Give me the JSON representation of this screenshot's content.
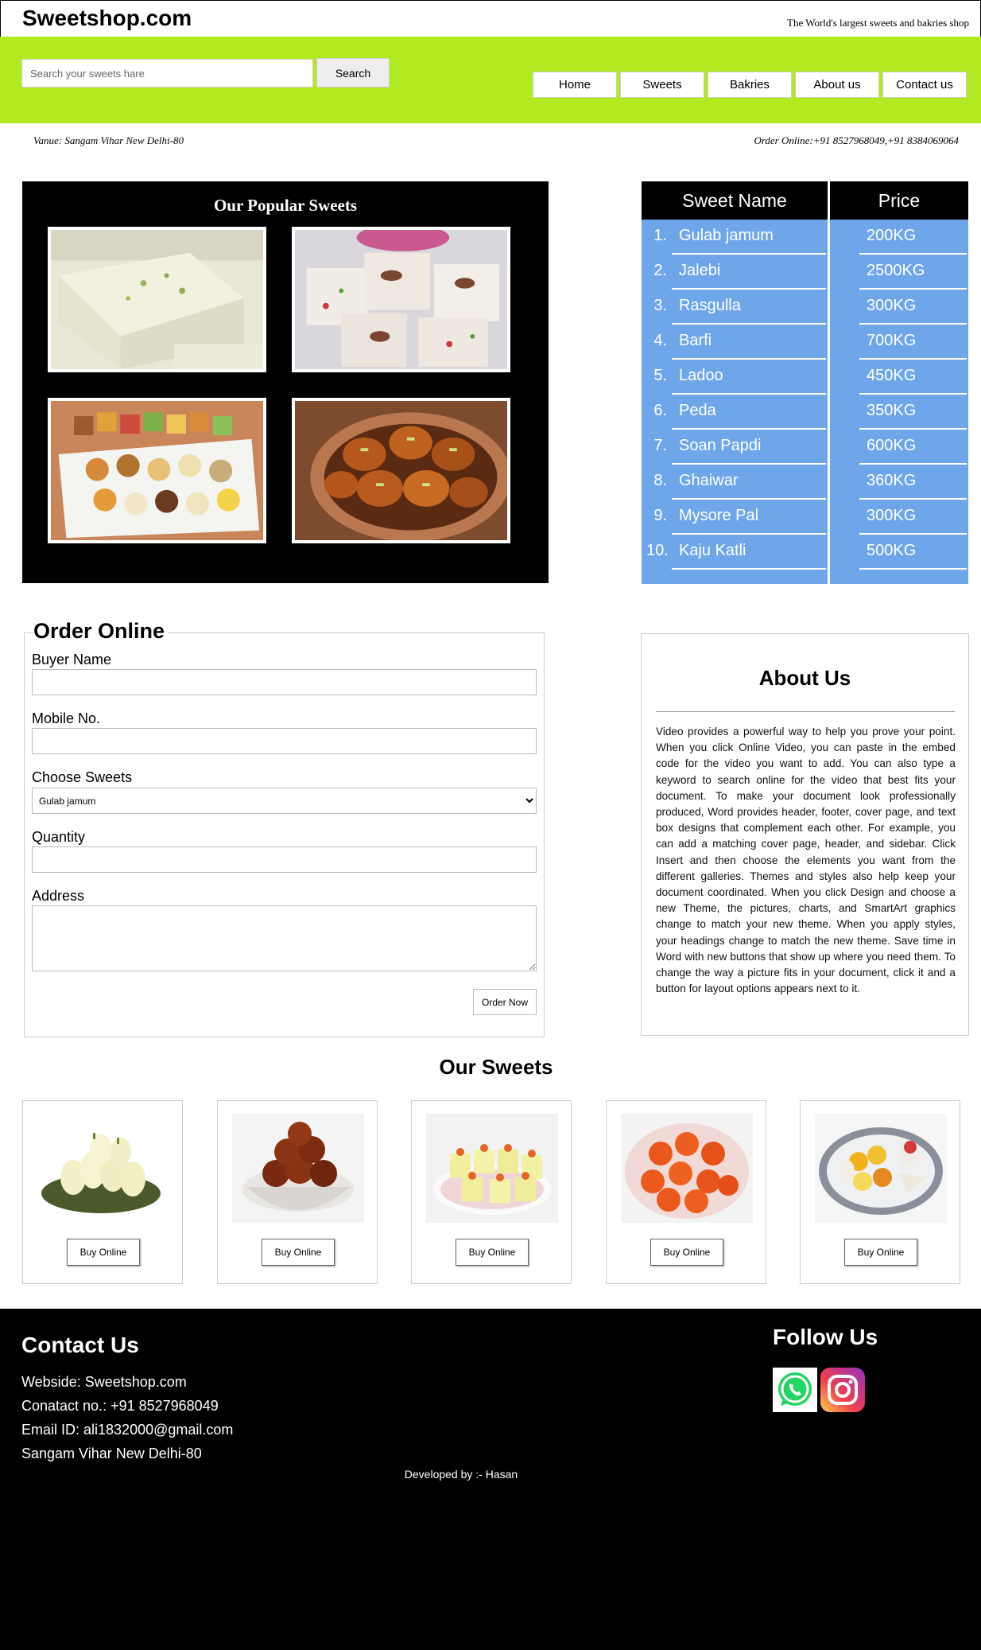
{
  "header": {
    "brand": "Sweetshop.com",
    "tagline": "The World's largest sweets and bakries shop"
  },
  "search": {
    "placeholder": "Search your sweets hare",
    "button_label": "Search"
  },
  "nav": {
    "items": [
      "Home",
      "Sweets",
      "Bakries",
      "About us",
      "Contact us"
    ]
  },
  "info": {
    "venue": "Vanue: Sangam Vihar New Delhi-80",
    "order_online": "Order Online:+91 8527968049,+91 8384069064"
  },
  "popular": {
    "title": "Our Popular Sweets",
    "images": [
      "kalakand-photo",
      "coconut-barfi-photo",
      "mixed-sweets-plate-photo",
      "gulab-jamun-bowl-photo"
    ]
  },
  "price_table": {
    "headers": [
      "Sweet Name",
      "Price"
    ],
    "rows": [
      {
        "num": "1.",
        "name": "Gulab jamum",
        "price": "200KG"
      },
      {
        "num": "2.",
        "name": "Jalebi",
        "price": "2500KG"
      },
      {
        "num": "3.",
        "name": "Rasgulla",
        "price": "300KG"
      },
      {
        "num": "4.",
        "name": "Barfi",
        "price": "700KG"
      },
      {
        "num": "5.",
        "name": "Ladoo",
        "price": "450KG"
      },
      {
        "num": "6.",
        "name": "Peda",
        "price": "350KG"
      },
      {
        "num": "7.",
        "name": "Soan Papdi",
        "price": "600KG"
      },
      {
        "num": "8.",
        "name": "Ghaiwar",
        "price": "360KG"
      },
      {
        "num": "9.",
        "name": "Mysore Pal",
        "price": "300KG"
      },
      {
        "num": "10.",
        "name": "Kaju Katli",
        "price": "500KG"
      }
    ],
    "colors": {
      "header": "#000000",
      "body": "#6fa6ea"
    }
  },
  "order_form": {
    "legend": "Order Online",
    "buyer_label": "Buyer Name",
    "mobile_label": "Mobile No.",
    "choose_label": "Choose Sweets",
    "choose_value": "Gulab jamum",
    "quantity_label": "Quantity",
    "address_label": "Address",
    "submit_label": "Order Now"
  },
  "about": {
    "title": "About Us",
    "text": "Video provides a powerful way to help you prove your point. When you click Online Video, you can paste in the embed code for the video you want to add. You can also type a keyword to search online for the video that best fits your document. To make your document look professionally produced, Word provides header, footer, cover page, and text box designs that complement each other. For example, you can add a matching cover page, header, and sidebar. Click Insert and then choose the elements you want from the different galleries. Themes and styles also help keep your document coordinated. When you click Design and choose a new Theme, the pictures, charts, and SmartArt graphics change to match your new theme. When you apply styles, your headings change to match the new theme. Save time in Word with new buttons that show up where you need them. To change the way a picture fits in your document, click it and a button for layout options appears next to it."
  },
  "our_sweets": {
    "title": "Our Sweets",
    "buy_label": "Buy Online",
    "cards": [
      "rasmalai-leaf-photo",
      "gulab-jamun-photo",
      "sandesh-photo",
      "ladoo-plate-photo",
      "assorted-sweets-photo"
    ]
  },
  "footer": {
    "contact_title": "Contact Us",
    "website": "Webside: Sweetshop.com",
    "phone": "Conatact no.: +91 8527968049",
    "email": "Email ID: ali1832000@gmail.com",
    "address": "Sangam Vihar New Delhi-80",
    "follow_title": "Follow Us",
    "social": [
      "whatsapp-icon",
      "instagram-icon"
    ],
    "developer": "Developed by :- Hasan"
  },
  "colors": {
    "accent": "#b2ea21",
    "table_blue": "#6fa6ea",
    "footer": "#000000"
  }
}
